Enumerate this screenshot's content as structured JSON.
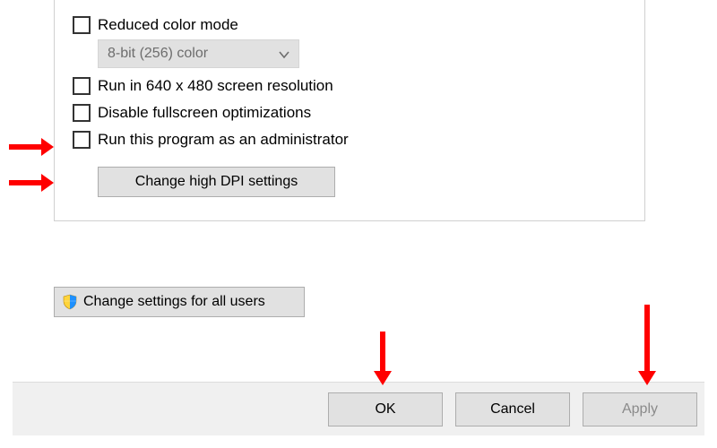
{
  "compat": {
    "reduced_color_label": "Reduced color mode",
    "color_depth_value": "8-bit (256) color",
    "run_640_label": "Run in 640 x 480 screen resolution",
    "disable_fullscreen_label": "Disable fullscreen optimizations",
    "run_as_admin_label": "Run this program as an administrator",
    "dpi_button_label": "Change high DPI settings"
  },
  "all_users_button_label": "Change settings for all users",
  "buttons": {
    "ok": "OK",
    "cancel": "Cancel",
    "apply": "Apply"
  },
  "icons": {
    "shield": "shield-icon",
    "chevron_down": "chevron-down-icon"
  },
  "annotation_color": "#ff0000"
}
